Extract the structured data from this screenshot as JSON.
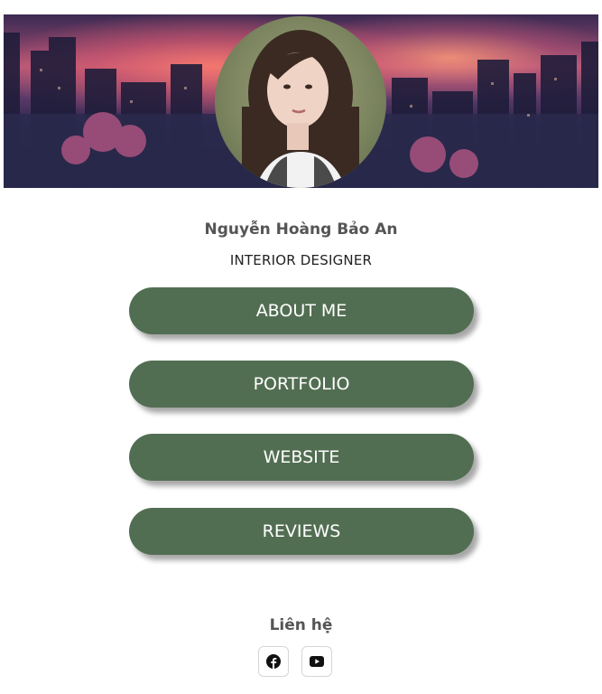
{
  "profile": {
    "name": "Nguyễn Hoàng Bảo An",
    "title": "INTERIOR DESIGNER"
  },
  "buttons": [
    {
      "label": "ABOUT ME"
    },
    {
      "label": "PORTFOLIO"
    },
    {
      "label": "WEBSITE"
    },
    {
      "label": "REVIEWS"
    }
  ],
  "contact": {
    "heading": "Liên hệ",
    "icons": [
      "facebook-icon",
      "youtube-icon"
    ]
  },
  "colors": {
    "button": "#526e52",
    "button_text": "#ffffff",
    "name_text": "#555555"
  }
}
